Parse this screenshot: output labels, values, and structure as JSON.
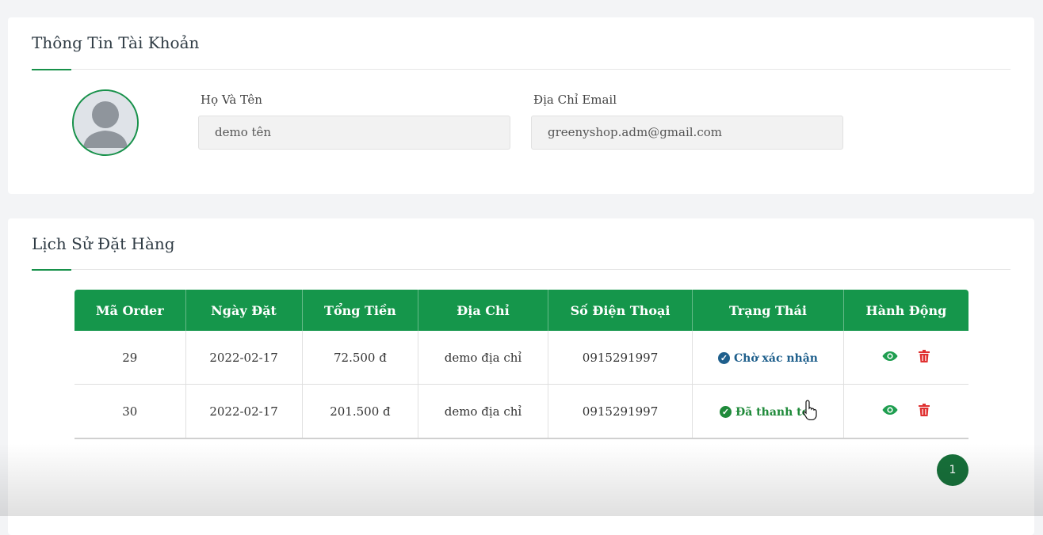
{
  "account": {
    "title": "Thông Tin Tài Khoản",
    "name_label": "Họ Và Tên",
    "name_value": "demo tên",
    "email_label": "Địa Chỉ Email",
    "email_value": "greenyshop.adm@gmail.com"
  },
  "history": {
    "title": "Lịch Sử Đặt Hàng",
    "columns": [
      "Mã Order",
      "Ngày Đặt",
      "Tổng Tiền",
      "Địa Chỉ",
      "Số Điện Thoại",
      "Trạng Thái",
      "Hành Động"
    ],
    "rows": [
      {
        "id": "29",
        "date": "2022-02-17",
        "total": "72.500 đ",
        "address": "demo địa chỉ",
        "phone": "0915291997",
        "status": "Chờ xác nhận"
      },
      {
        "id": "30",
        "date": "2022-02-17",
        "total": "201.500 đ",
        "address": "demo địa chỉ",
        "phone": "0915291997",
        "status": "Đã thanh toa"
      }
    ],
    "pagination": {
      "current_page": "1"
    }
  },
  "colors": {
    "accent": "#15964b",
    "status_pending": "#1e5f8c",
    "status_paid": "#1f8a3a",
    "delete": "#e03131"
  },
  "icons": [
    "user-avatar-icon",
    "check-circle-icon",
    "eye-icon",
    "trash-icon",
    "pointer-cursor-icon"
  ]
}
